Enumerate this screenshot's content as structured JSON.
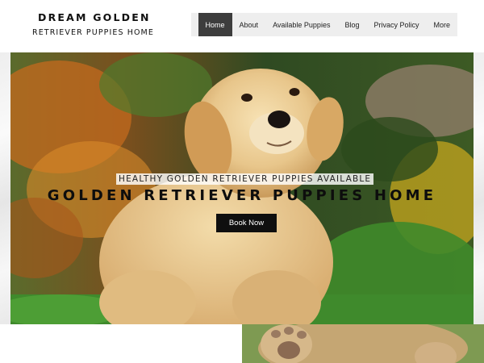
{
  "header": {
    "brand_line1": "DREAM GOLDEN",
    "brand_line2": "RETRIEVER  PUPPIES HOME"
  },
  "nav": {
    "items": [
      {
        "label": "Home",
        "active": true
      },
      {
        "label": "About",
        "active": false
      },
      {
        "label": "Available Puppies",
        "active": false
      },
      {
        "label": "Blog",
        "active": false
      },
      {
        "label": "Privacy Policy",
        "active": false
      },
      {
        "label": "More",
        "active": false
      }
    ]
  },
  "hero": {
    "subtitle": "HEALTHY GOLDEN RETRIEVER PUPPIES AVAILABLE",
    "title": "GOLDEN RETRIEVER PUPPIES HOME",
    "button_label": "Book Now",
    "image": "golden-retriever-puppy-photo"
  },
  "colors": {
    "nav_active_bg": "#3d3d3d",
    "nav_bg": "#eeeeee",
    "button_bg": "#0f0f0f",
    "text": "#111111"
  }
}
